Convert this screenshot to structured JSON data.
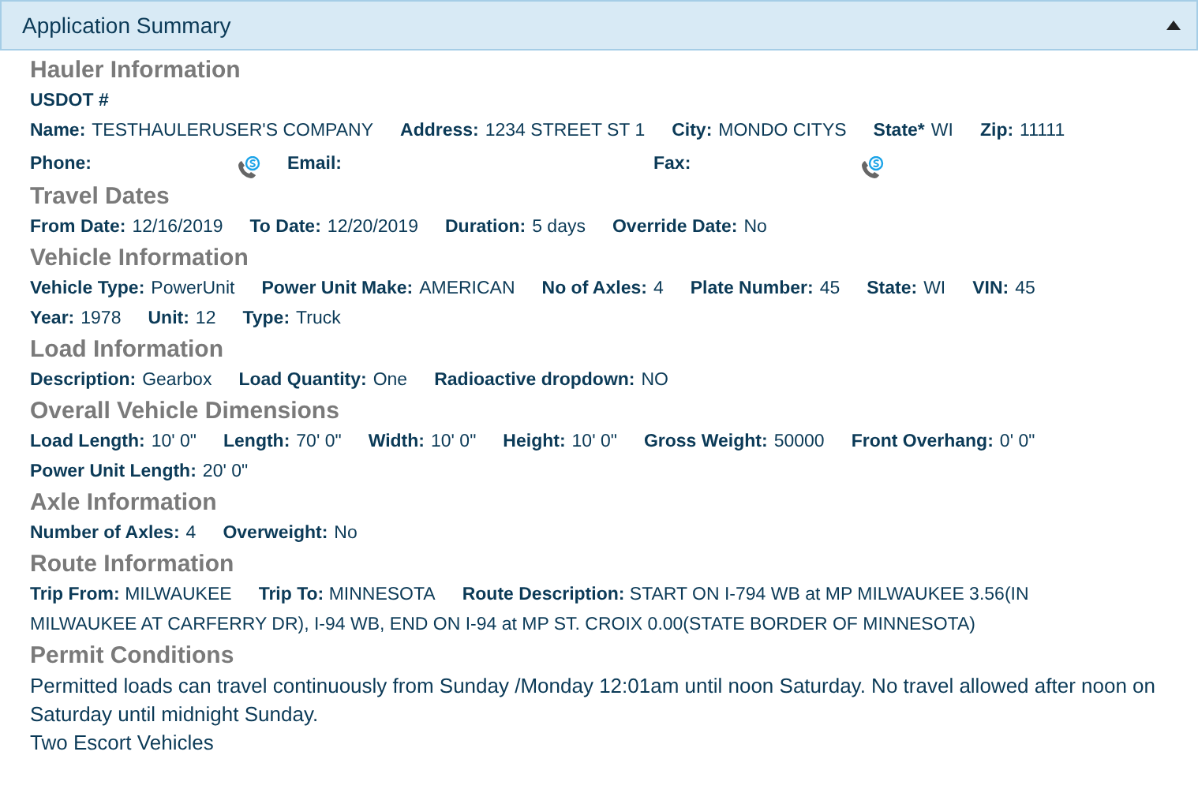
{
  "panel": {
    "title": "Application Summary",
    "expanded": true
  },
  "sections": [
    {
      "title": "Hauler Information",
      "lines": [
        {
          "fields": [
            {
              "label": "USDOT #"
            }
          ]
        },
        {
          "fields": [
            {
              "label": "Name:",
              "value": "TESTHAULERUSER'S COMPANY"
            },
            {
              "label": "Address:",
              "value": "1234 STREET ST 1"
            },
            {
              "label": "City:",
              "value": "MONDO CITYS"
            },
            {
              "label": "State*",
              "value": "WI"
            },
            {
              "label": "Zip:",
              "value": "11111"
            }
          ]
        },
        {
          "fields": [
            {
              "label": "Phone:",
              "kind": "phone"
            },
            {
              "label": "Email:",
              "kind": "email"
            },
            {
              "label": "Fax:",
              "kind": "phone"
            }
          ]
        }
      ]
    },
    {
      "title": "Travel Dates",
      "lines": [
        {
          "fields": [
            {
              "label": "From Date:",
              "value": "12/16/2019"
            },
            {
              "label": "To Date:",
              "value": "12/20/2019"
            },
            {
              "label": "Duration:",
              "value": "5 days"
            },
            {
              "label": "Override Date:",
              "value": "No"
            }
          ]
        }
      ]
    },
    {
      "title": "Vehicle Information",
      "lines": [
        {
          "fields": [
            {
              "label": "Vehicle Type:",
              "value": "PowerUnit"
            },
            {
              "label": "Power Unit Make:",
              "value": "AMERICAN"
            },
            {
              "label": "No of Axles:",
              "value": "4"
            },
            {
              "label": "Plate Number:",
              "value": "45"
            },
            {
              "label": "State:",
              "value": "WI"
            },
            {
              "label": "VIN:",
              "value": "45"
            }
          ]
        },
        {
          "fields": [
            {
              "label": "Year:",
              "value": "1978"
            },
            {
              "label": "Unit:",
              "value": "12"
            },
            {
              "label": "Type:",
              "value": "Truck"
            }
          ]
        }
      ]
    },
    {
      "title": "Load Information",
      "lines": [
        {
          "fields": [
            {
              "label": "Description:",
              "value": "Gearbox"
            },
            {
              "label": "Load Quantity:",
              "value": "One"
            },
            {
              "label": "Radioactive dropdown:",
              "value": "NO"
            }
          ]
        }
      ]
    },
    {
      "title": "Overall Vehicle Dimensions",
      "lines": [
        {
          "fields": [
            {
              "label": "Load Length:",
              "value": "10' 0\""
            },
            {
              "label": "Length:",
              "value": "70' 0\""
            },
            {
              "label": "Width:",
              "value": "10' 0\""
            },
            {
              "label": "Height:",
              "value": "10' 0\""
            },
            {
              "label": "Gross Weight:",
              "value": "50000"
            },
            {
              "label": "Front Overhang:",
              "value": "0' 0\""
            }
          ]
        },
        {
          "fields": [
            {
              "label": "Power Unit Length:",
              "value": "20' 0\""
            }
          ]
        }
      ]
    },
    {
      "title": "Axle Information",
      "lines": [
        {
          "fields": [
            {
              "label": "Number of Axles:",
              "value": "4"
            },
            {
              "label": "Overweight:",
              "value": "No"
            }
          ]
        }
      ]
    },
    {
      "title": "Route Information",
      "lines": [
        {
          "kind": "wrapped",
          "fields": [
            {
              "label": "Trip From:",
              "value": "MILWAUKEE"
            },
            {
              "label": "Trip To:",
              "value": "MINNESOTA"
            },
            {
              "label": "Route Description:",
              "value": "START ON I-794 WB at MP MILWAUKEE 3.56(IN MILWAUKEE AT CARFERRY DR), I-94 WB, END ON I-94 at MP ST. CROIX 0.00(STATE BORDER OF MINNESOTA)"
            }
          ]
        }
      ]
    },
    {
      "title": "Permit Conditions",
      "paragraphs": [
        "Permitted loads can travel continuously from Sunday /Monday 12:01am until noon Saturday. No travel allowed after noon on Saturday until midnight Sunday.",
        "Two Escort Vehicles"
      ]
    }
  ]
}
